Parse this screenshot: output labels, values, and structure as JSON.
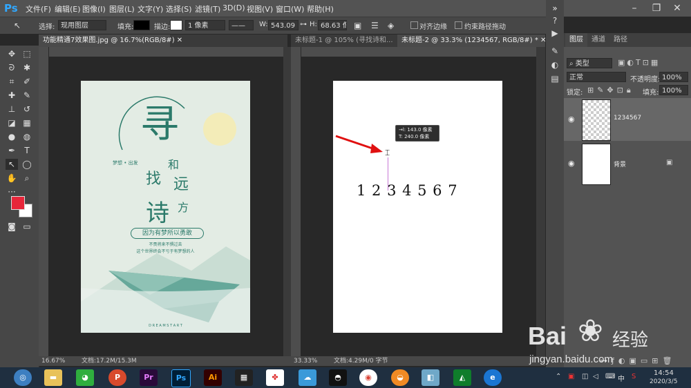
{
  "app": {
    "logo": "Ps"
  },
  "menubar": {
    "items": [
      "文件(F)",
      "编辑(E)",
      "图像(I)",
      "图层(L)",
      "文字(Y)",
      "选择(S)",
      "滤镜(T)",
      "3D(D)",
      "视图(V)",
      "窗口(W)",
      "帮助(H)"
    ]
  },
  "options": {
    "select_label": "选择:",
    "select_value": "现用图层",
    "fill_label": "填充:",
    "stroke_label": "描边:",
    "stroke_width": "1 像素",
    "w_label": "W:",
    "w_value": "543.09",
    "h_label": "H:",
    "h_value": "68.63 像",
    "align_edges": "对齐边缘",
    "constrain_path": "约束路径拖动"
  },
  "tabs": {
    "left": {
      "title": "功能精通7效果图.jpg @ 16.7%(RGB/8#)"
    },
    "right": [
      {
        "title": "未标题-1 @ 105% (寻找诗和..."
      },
      {
        "title": "未标题-2 @ 33.3% (1234567, RGB/8#) *"
      }
    ]
  },
  "poster": {
    "char1": "寻",
    "char2": "找",
    "char3": "诗",
    "char4": "和",
    "char5": "远",
    "char6": "方",
    "subtitle": "梦想 • 出发",
    "slogan": "因为有梦所以勇敢",
    "line1": "不畏将来不惧过去",
    "line2": "这个世界终会不亏于有梦想的人",
    "bottom": "D R E A M  S T A R T"
  },
  "canvas": {
    "tooltip_line1": "143.0 像素",
    "tooltip_line2": "240.0 像素",
    "number_text": "1 2 3 4 5 6 7"
  },
  "status": {
    "left_zoom": "16.67%",
    "left_doc": "文档:17.2M/15.3M",
    "right_zoom": "33.33%",
    "right_doc": "文档:4.29M/0 字节"
  },
  "layers_panel": {
    "tabs": [
      "图层",
      "通道",
      "路径"
    ],
    "kind": "类型",
    "blend": "正常",
    "opacity_label": "不透明度:",
    "opacity_value": "100%",
    "lock_label": "锁定:",
    "fill_label": "填充:",
    "fill_value": "100%",
    "layers": [
      {
        "name": "1234567"
      },
      {
        "name": "背景"
      }
    ]
  },
  "watermark": {
    "brand": "Bai",
    "brand_cn": "经验",
    "url": "jingyan.baidu.com"
  },
  "taskbar": {
    "apps": [
      "Pr",
      "Ps",
      "Ai"
    ],
    "time": "14:54",
    "date": "2020/3/5"
  },
  "colors": {
    "accent": "#31a8ff",
    "foreground": "#e8263a",
    "poster_bg": "#e3ece4",
    "poster_green": "#2b7a6a"
  }
}
